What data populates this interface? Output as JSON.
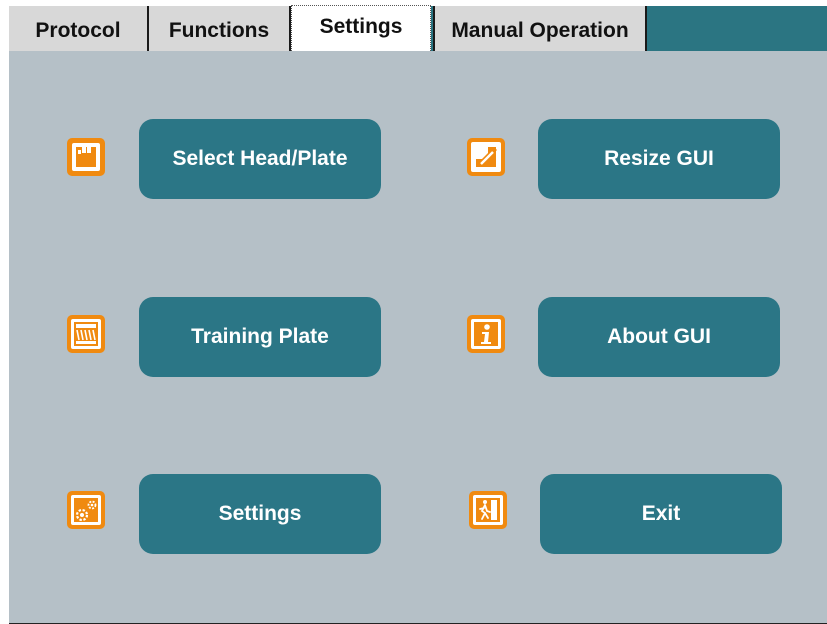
{
  "tabs": {
    "protocol": "Protocol",
    "functions": "Functions",
    "settings": "Settings",
    "manual": "Manual Operation"
  },
  "buttons": {
    "select_head_plate": "Select Head/Plate",
    "resize_gui": "Resize GUI",
    "training_plate": "Training Plate",
    "about_gui": "About GUI",
    "settings": "Settings",
    "exit": "Exit"
  },
  "icons": {
    "select_head_plate": "hand-pointer-icon",
    "resize_gui": "resize-arrow-icon",
    "training_plate": "training-plate-icon",
    "about_gui": "info-icon",
    "settings": "gears-icon",
    "exit": "exit-door-icon"
  },
  "colors": {
    "accent": "#2b7686",
    "icon": "#f08a10",
    "panel": "#b5c0c7",
    "tab_inactive": "#d8d8d8",
    "tab_active": "#ffffff"
  }
}
